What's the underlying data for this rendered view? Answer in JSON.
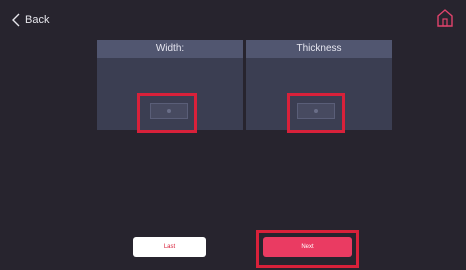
{
  "header": {
    "back_label": "Back",
    "back_icon": "chevron-left-icon",
    "home_icon": "home-icon"
  },
  "panels": [
    {
      "title": "Width:"
    },
    {
      "title": "Thickness"
    }
  ],
  "footer": {
    "last_label": "Last",
    "next_label": "Next"
  },
  "colors": {
    "background": "#27242e",
    "panel": "#3b3e52",
    "panel_header": "#515670",
    "highlight": "#d8213a",
    "next_button": "#ea3b62",
    "home_icon": "#e0436c"
  }
}
